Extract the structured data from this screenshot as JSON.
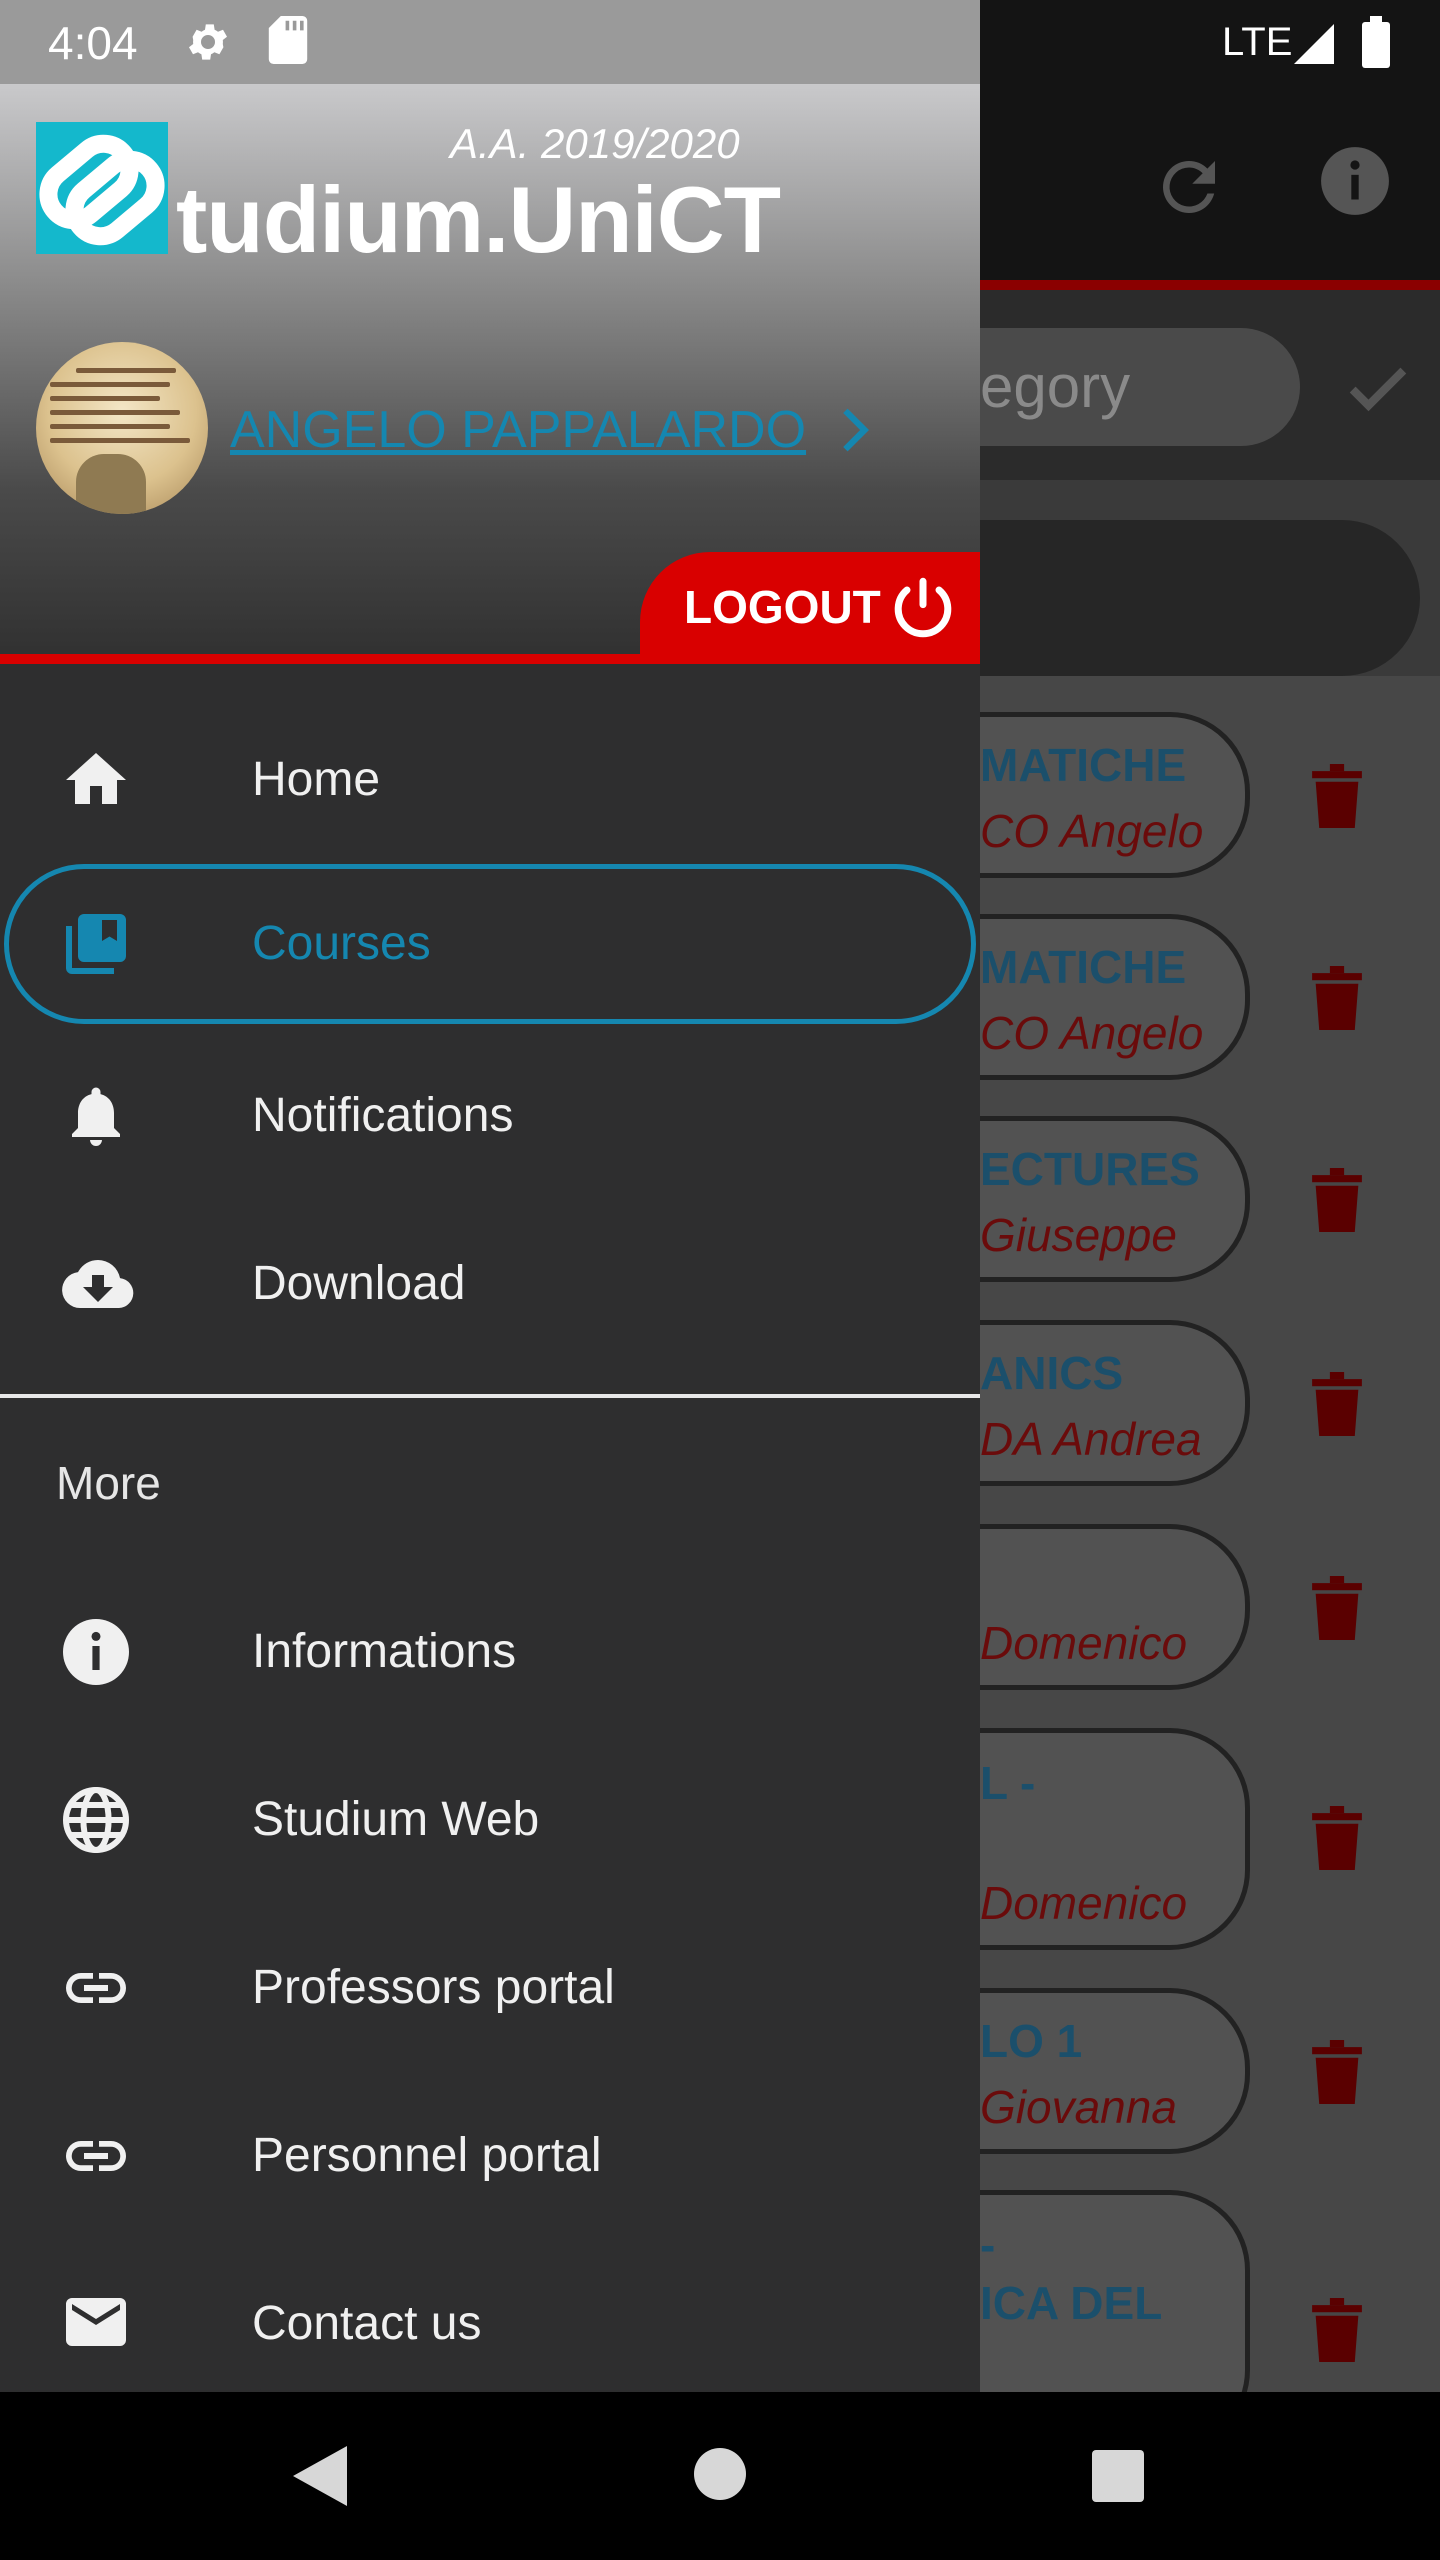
{
  "status_bar": {
    "time": "4:04",
    "network": "LTE"
  },
  "background_app": {
    "category_placeholder_visible": "egory",
    "cards": [
      {
        "title": "MATICHE",
        "subtitle": "CO Angelo"
      },
      {
        "title": "MATICHE",
        "subtitle": "CO Angelo"
      },
      {
        "title": "ECTURES",
        "subtitle": "Giuseppe"
      },
      {
        "title": "ANICS",
        "subtitle": "DA Andrea"
      },
      {
        "title": "",
        "subtitle": "Domenico"
      },
      {
        "title": "L -",
        "subtitle": "Domenico"
      },
      {
        "title": "LO 1",
        "subtitle": "Giovanna"
      },
      {
        "title": "-",
        "subtitle": "ICA DEL"
      }
    ]
  },
  "drawer": {
    "academic_year": "A.A. 2019/2020",
    "app_name": "tudium.UniCT",
    "user_name": "ANGELO PAPPALARDO",
    "logout_label": "LOGOUT",
    "main_items": [
      {
        "label": "Home",
        "icon": "home-icon"
      },
      {
        "label": "Courses",
        "icon": "library-books-icon",
        "selected": true
      },
      {
        "label": "Notifications",
        "icon": "bell-icon"
      },
      {
        "label": "Download",
        "icon": "cloud-download-icon"
      }
    ],
    "more_label": "More",
    "more_items": [
      {
        "label": "Informations",
        "icon": "info-icon"
      },
      {
        "label": "Studium Web",
        "icon": "globe-icon"
      },
      {
        "label": "Professors portal",
        "icon": "link-icon"
      },
      {
        "label": "Personnel portal",
        "icon": "link-icon"
      },
      {
        "label": "Contact us",
        "icon": "mail-icon"
      }
    ]
  },
  "colors": {
    "accent_blue": "#1587b0",
    "logout_red": "#d90000",
    "logo_cyan": "#14b8cc",
    "drawer_bg": "#2e2e2f"
  }
}
